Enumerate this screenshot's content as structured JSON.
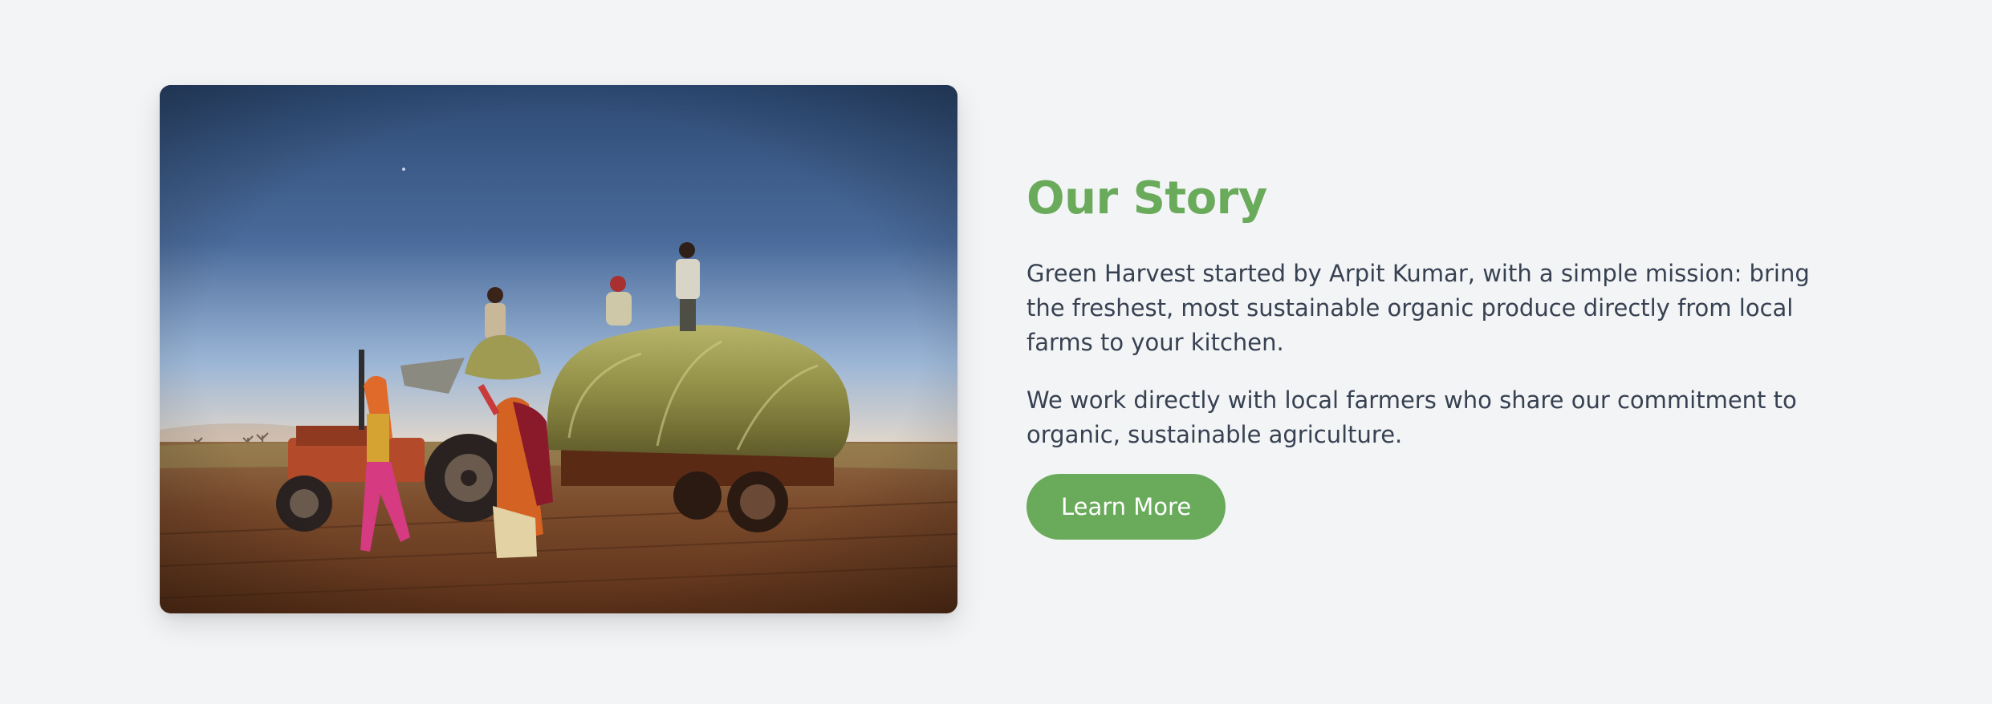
{
  "story": {
    "title": "Our Story",
    "paragraph_1": "Green Harvest started by Arpit Kumar, with a simple mission: bring the freshest, most sustainable organic produce directly from local farms to your kitchen.",
    "paragraph_2": "We work directly with local farmers who share our commitment to organic, sustainable agriculture.",
    "cta_label": "Learn More"
  },
  "image": {
    "subject": "farmers loading harvested crops onto a tractor trailer in a field at dusk"
  },
  "colors": {
    "accent": "#6aab5b",
    "page_background": "#f3f4f6",
    "body_text": "#374151",
    "button_text": "#ffffff"
  }
}
